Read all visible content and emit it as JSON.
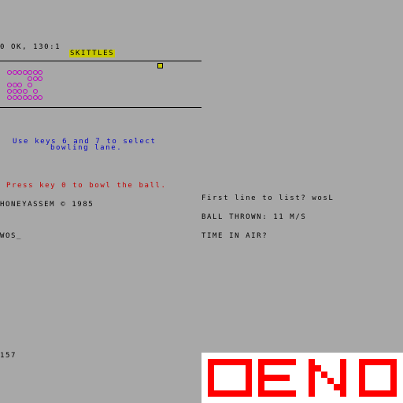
{
  "status_line": "0 OK, 130:1",
  "game_title": "SKITTLES",
  "instructions": {
    "line1": "Use keys 6 and 7 to select",
    "line2": "bowling lane.",
    "line3": "Press key 0 to bowl the ball."
  },
  "copyright": "HONEYASSEM © 1985",
  "input_prompt": "WOS_",
  "line_number": "157",
  "right_panel": {
    "list_prompt": "First line to list? wosL",
    "ball_thrown": "BALL THROWN: 11 M/S",
    "time_prompt": "TIME IN AIR?"
  },
  "logo_text": "OENO",
  "colors": {
    "background": "#a8a8a8",
    "pins": "#c000c0",
    "instructions_blue": "#0000c0",
    "instructions_red": "#c00000",
    "title_banner": "#c8c800",
    "logo_red": "#ff0000",
    "logo_bg": "#ffffff"
  },
  "pin_rows": [
    "OOOOOOO",
    "    OOO",
    "OOO O",
    "OOOO O",
    "OOOOOOO"
  ]
}
